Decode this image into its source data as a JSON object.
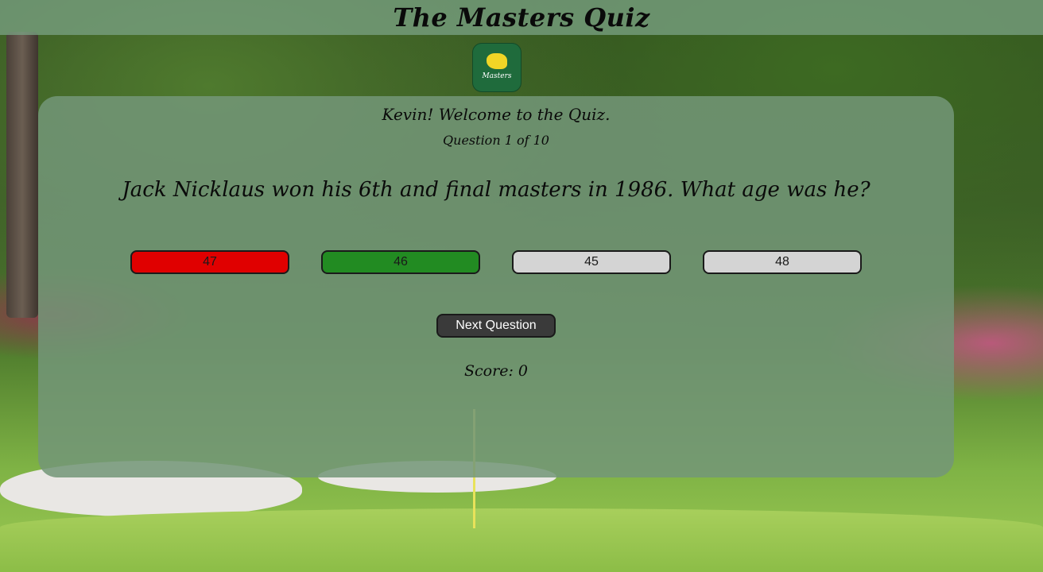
{
  "header": {
    "title": "The Masters Quiz"
  },
  "logo": {
    "icon": "masters-logo-icon",
    "text": "Masters",
    "background_color": "#1f6b3c",
    "map_color": "#f0d526"
  },
  "quiz": {
    "welcome": "Kevin! Welcome to the Quiz.",
    "counter": "Question 1 of 10",
    "question": "Jack Nicklaus won his 6th and final masters in 1986. What age was he?",
    "answers": [
      {
        "label": "47",
        "state": "incorrect",
        "color": "#e00000"
      },
      {
        "label": "46",
        "state": "correct",
        "color": "#228b22"
      },
      {
        "label": "45",
        "state": "default",
        "color": "#d4d4d4"
      },
      {
        "label": "48",
        "state": "default",
        "color": "#d4d4d4"
      }
    ],
    "next_button": "Next Question",
    "score": "Score: 0"
  }
}
